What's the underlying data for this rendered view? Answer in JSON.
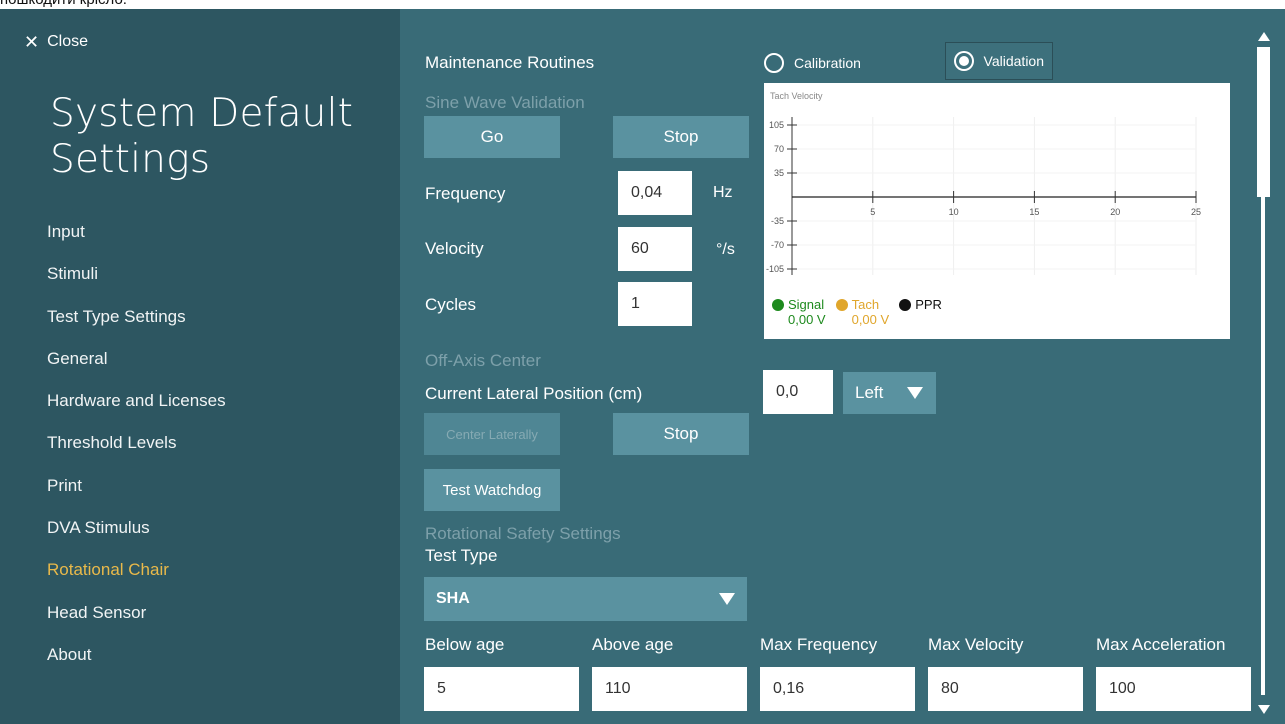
{
  "caption": "пошкодити крісло.",
  "sidebar": {
    "close_label": "Close",
    "title": "System Default Settings",
    "items": [
      {
        "label": "Input"
      },
      {
        "label": "Stimuli"
      },
      {
        "label": "Test Type Settings"
      },
      {
        "label": "General"
      },
      {
        "label": "Hardware and Licenses"
      },
      {
        "label": "Threshold Levels"
      },
      {
        "label": "Print"
      },
      {
        "label": "DVA Stimulus"
      },
      {
        "label": "Rotational Chair"
      },
      {
        "label": "Head Sensor"
      },
      {
        "label": "About"
      }
    ],
    "active_index": 8
  },
  "main": {
    "maintenance_title": "Maintenance Routines",
    "radio_calibration": "Calibration",
    "radio_validation": "Validation",
    "sine_title": "Sine Wave Validation",
    "go_label": "Go",
    "stop_label": "Stop",
    "frequency_label": "Frequency",
    "frequency_value": "0,04",
    "frequency_unit": "Hz",
    "velocity_label": "Velocity",
    "velocity_value": "60",
    "velocity_unit": "°/s",
    "cycles_label": "Cycles",
    "cycles_value": "1",
    "offaxis_title": "Off-Axis Center",
    "lateral_label": "Current Lateral Position (cm)",
    "lateral_value": "0,0",
    "lateral_dir": "Left",
    "center_laterally_label": "Center Laterally",
    "stop2_label": "Stop",
    "watchdog_label": "Test Watchdog",
    "safety_title": "Rotational Safety Settings",
    "test_type_label": "Test Type",
    "test_type_value": "SHA",
    "below_age_label": "Below age",
    "below_age_value": "5",
    "above_age_label": "Above age",
    "above_age_value": "110",
    "max_freq_label": "Max Frequency",
    "max_freq_value": "0,16",
    "max_vel_label": "Max Velocity",
    "max_vel_value": "80",
    "max_acc_label": "Max Acceleration",
    "max_acc_value": "100"
  },
  "chart_data": {
    "type": "line",
    "title": "Tach Velocity",
    "xlim": [
      0,
      25
    ],
    "ylim": [
      -105,
      105
    ],
    "x_ticks": [
      5,
      10,
      15,
      20,
      25
    ],
    "y_ticks": [
      105,
      70,
      35,
      -35,
      -70,
      -105
    ],
    "grid": true,
    "series": [
      {
        "name": "Signal",
        "value": "0,00 V",
        "color": "#1e8a1e"
      },
      {
        "name": "Tach",
        "value": "0,00 V",
        "color": "#e0a62c"
      },
      {
        "name": "PPR",
        "value": "",
        "color": "#111111"
      }
    ]
  },
  "colors": {
    "sidebar_bg": "#2d5661",
    "content_bg": "#396b77",
    "button_bg": "#5a92a0",
    "active_nav": "#e9b94a"
  }
}
